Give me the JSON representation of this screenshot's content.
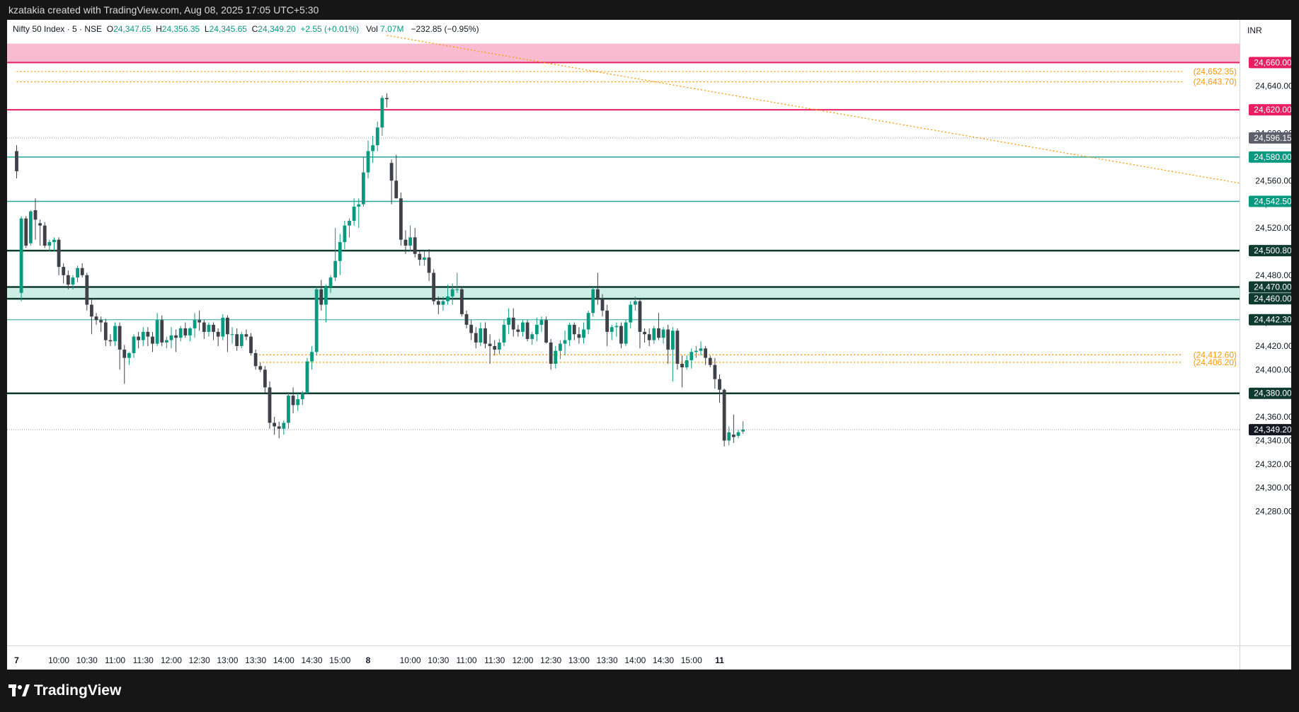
{
  "header": {
    "attribution": "kzatakia created with TradingView.com, Aug 08, 2025 17:05 UTC+5:30"
  },
  "brand": {
    "name": "TradingView",
    "logo_icon": "tradingview-logo-icon"
  },
  "legend": {
    "symbol": "Nifty 50 Index · 5 · NSE",
    "open_label": "O",
    "open": "24,347.65",
    "high_label": "H",
    "high": "24,356.35",
    "low_label": "L",
    "low": "24,345.65",
    "close_label": "C",
    "close": "24,349.20",
    "change": "+2.55 (+0.01%)",
    "vol_label": "Vol",
    "vol": "7.07M",
    "day_change": "−232.85 (−0.95%)"
  },
  "currency": "INR",
  "colors": {
    "up": "#089981",
    "down": "#3f4149",
    "resistance": "#e91e63",
    "resistance_zone": "#f8bbd0",
    "teal_line": "#26a69a",
    "dark_line": "#0e3b2e",
    "support_zone": "#cdeee6",
    "orange": "#ff9800",
    "current_price": "#131722"
  },
  "chart_data": {
    "type": "candlestick",
    "title": "Nifty 50 Index · 5 · NSE",
    "ylim": [
      24260,
      24665
    ],
    "y_ticks": [
      "24,280.00",
      "24,300.00",
      "24,320.00",
      "24,340.00",
      "24,360.00",
      "24,380.00",
      "24,400.00",
      "24,420.00",
      "24,440.00",
      "24,460.00",
      "24,480.00",
      "24,500.00",
      "24,520.00",
      "24,540.00",
      "24,560.00",
      "24,580.00",
      "24,600.00",
      "24,620.00",
      "24,640.00",
      "24,660.00"
    ],
    "x_ticks": [
      {
        "label": "7",
        "bar": 0
      },
      {
        "label": "10:00",
        "bar": 9
      },
      {
        "label": "10:30",
        "bar": 15
      },
      {
        "label": "11:00",
        "bar": 21
      },
      {
        "label": "11:30",
        "bar": 27
      },
      {
        "label": "12:00",
        "bar": 33
      },
      {
        "label": "12:30",
        "bar": 39
      },
      {
        "label": "13:00",
        "bar": 45
      },
      {
        "label": "13:30",
        "bar": 51
      },
      {
        "label": "14:00",
        "bar": 57
      },
      {
        "label": "14:30",
        "bar": 63
      },
      {
        "label": "15:00",
        "bar": 69
      },
      {
        "label": "8",
        "bar": 75
      },
      {
        "label": "10:00",
        "bar": 84
      },
      {
        "label": "10:30",
        "bar": 90
      },
      {
        "label": "11:00",
        "bar": 96
      },
      {
        "label": "11:30",
        "bar": 102
      },
      {
        "label": "12:00",
        "bar": 108
      },
      {
        "label": "12:30",
        "bar": 114
      },
      {
        "label": "13:00",
        "bar": 120
      },
      {
        "label": "13:30",
        "bar": 126
      },
      {
        "label": "14:00",
        "bar": 132
      },
      {
        "label": "14:30",
        "bar": 138
      },
      {
        "label": "15:00",
        "bar": 144
      },
      {
        "label": "11",
        "bar": 150
      }
    ],
    "levels": [
      {
        "price": 24660.0,
        "label": "24,660.00",
        "style": "resistance"
      },
      {
        "price": 24620.0,
        "label": "24,620.00",
        "style": "resistance"
      },
      {
        "price": 24596.15,
        "label": "24,596.15",
        "style": "prev-close"
      },
      {
        "price": 24580.0,
        "label": "24,580.00",
        "style": "teal"
      },
      {
        "price": 24542.5,
        "label": "24,542.50",
        "style": "teal"
      },
      {
        "price": 24500.8,
        "label": "24,500.80",
        "style": "dark"
      },
      {
        "price": 24470.0,
        "label": "24,470.00",
        "style": "dark"
      },
      {
        "price": 24460.0,
        "label": "24,460.00",
        "style": "dark"
      },
      {
        "price": 24442.3,
        "label": "24,442.30",
        "style": "teal-thin"
      },
      {
        "price": 24380.0,
        "label": "24,380.00",
        "style": "dark"
      },
      {
        "price": 24349.2,
        "label": "24,349.20",
        "style": "current"
      }
    ],
    "dotted_levels": [
      {
        "price": 24652.35,
        "label": "(24,652.35)",
        "from_bar": 0
      },
      {
        "price": 24643.7,
        "label": "(24,643.70)",
        "from_bar": 0
      },
      {
        "price": 24412.6,
        "label": "(24,412.60)",
        "from_bar": 51
      },
      {
        "price": 24406.2,
        "label": "(24,406.20)",
        "from_bar": 51
      }
    ],
    "zones": [
      {
        "from": 24660,
        "to": 24676,
        "style": "resistance-zone"
      },
      {
        "from": 24460,
        "to": 24470,
        "style": "support-zone"
      }
    ],
    "trendline": {
      "bar1": 79,
      "price1": 24683,
      "bar2": 159,
      "price2": 24628
    },
    "candles": [
      [
        24585,
        24590,
        24562,
        24568
      ],
      [
        24465,
        24530,
        24458,
        24528
      ],
      [
        24528,
        24530,
        24503,
        24505
      ],
      [
        24507,
        24535,
        24505,
        24534
      ],
      [
        24535,
        24545,
        24510,
        24527
      ],
      [
        24524,
        24527,
        24505,
        24522
      ],
      [
        24522,
        24525,
        24503,
        24505
      ],
      [
        24505,
        24510,
        24500,
        24508
      ],
      [
        24508,
        24512,
        24500,
        24510
      ],
      [
        24510,
        24512,
        24480,
        24487
      ],
      [
        24487,
        24490,
        24473,
        24480
      ],
      [
        24480,
        24484,
        24468,
        24472
      ],
      [
        24472,
        24480,
        24468,
        24478
      ],
      [
        24478,
        24488,
        24474,
        24486
      ],
      [
        24486,
        24490,
        24478,
        24480
      ],
      [
        24480,
        24482,
        24450,
        24455
      ],
      [
        24455,
        24460,
        24430,
        24445
      ],
      [
        24445,
        24448,
        24438,
        24442
      ],
      [
        24442,
        24445,
        24432,
        24440
      ],
      [
        24440,
        24443,
        24420,
        24425
      ],
      [
        24425,
        24430,
        24420,
        24424
      ],
      [
        24424,
        24440,
        24420,
        24437
      ],
      [
        24437,
        24440,
        24400,
        24417
      ],
      [
        24417,
        24421,
        24388,
        24410
      ],
      [
        24410,
        24415,
        24404,
        24414
      ],
      [
        24414,
        24430,
        24410,
        24428
      ],
      [
        24428,
        24432,
        24418,
        24425
      ],
      [
        24425,
        24436,
        24420,
        24432
      ],
      [
        24432,
        24436,
        24420,
        24428
      ],
      [
        24428,
        24432,
        24415,
        24422
      ],
      [
        24422,
        24448,
        24420,
        24442
      ],
      [
        24442,
        24446,
        24420,
        24423
      ],
      [
        24423,
        24428,
        24418,
        24425
      ],
      [
        24425,
        24436,
        24418,
        24429
      ],
      [
        24429,
        24434,
        24415,
        24427
      ],
      [
        24427,
        24437,
        24424,
        24435
      ],
      [
        24435,
        24440,
        24427,
        24429
      ],
      [
        24429,
        24436,
        24424,
        24435
      ],
      [
        24435,
        24448,
        24427,
        24442
      ],
      [
        24442,
        24450,
        24433,
        24440
      ],
      [
        24440,
        24442,
        24426,
        24432
      ],
      [
        24432,
        24440,
        24428,
        24438
      ],
      [
        24438,
        24440,
        24425,
        24432
      ],
      [
        24432,
        24435,
        24420,
        24428
      ],
      [
        24428,
        24447,
        24425,
        24444
      ],
      [
        24444,
        24446,
        24415,
        24430
      ],
      [
        24430,
        24436,
        24422,
        24430
      ],
      [
        24430,
        24435,
        24416,
        24420
      ],
      [
        24420,
        24432,
        24418,
        24430
      ],
      [
        24430,
        24434,
        24425,
        24428
      ],
      [
        24428,
        24431,
        24412,
        24414
      ],
      [
        24414,
        24417,
        24400,
        24403
      ],
      [
        24403,
        24406,
        24398,
        24400
      ],
      [
        24400,
        24403,
        24380,
        24385
      ],
      [
        24385,
        24390,
        24350,
        24355
      ],
      [
        24355,
        24360,
        24345,
        24352
      ],
      [
        24352,
        24356,
        24342,
        24350
      ],
      [
        24350,
        24357,
        24345,
        24355
      ],
      [
        24355,
        24380,
        24350,
        24378
      ],
      [
        24378,
        24385,
        24363,
        24370
      ],
      [
        24370,
        24380,
        24365,
        24375
      ],
      [
        24375,
        24382,
        24370,
        24380
      ],
      [
        24380,
        24410,
        24380,
        24407
      ],
      [
        24407,
        24420,
        24400,
        24415
      ],
      [
        24415,
        24470,
        24412,
        24468
      ],
      [
        24468,
        24476,
        24450,
        24455
      ],
      [
        24455,
        24472,
        24440,
        24470
      ],
      [
        24470,
        24480,
        24465,
        24478
      ],
      [
        24478,
        24520,
        24475,
        24492
      ],
      [
        24492,
        24515,
        24480,
        24508
      ],
      [
        24508,
        24526,
        24502,
        24522
      ],
      [
        24522,
        24528,
        24512,
        24526
      ],
      [
        24526,
        24545,
        24522,
        24538
      ],
      [
        24538,
        24545,
        24520,
        24540
      ],
      [
        24540,
        24580,
        24538,
        24567
      ],
      [
        24567,
        24594,
        24562,
        24585
      ],
      [
        24585,
        24598,
        24575,
        24590
      ],
      [
        24590,
        24610,
        24585,
        24605
      ],
      [
        24605,
        24632,
        24598,
        24630
      ],
      [
        24630,
        24634,
        24622,
        24629
      ],
      [
        24575,
        24578,
        24540,
        24560
      ],
      [
        24560,
        24582,
        24555,
        24545
      ],
      [
        24545,
        24550,
        24505,
        24510
      ],
      [
        24510,
        24518,
        24498,
        24505
      ],
      [
        24505,
        24522,
        24500,
        24512
      ],
      [
        24512,
        24520,
        24495,
        24498
      ],
      [
        24498,
        24500,
        24488,
        24493
      ],
      [
        24493,
        24500,
        24488,
        24495
      ],
      [
        24495,
        24502,
        24475,
        24482
      ],
      [
        24482,
        24485,
        24455,
        24458
      ],
      [
        24458,
        24462,
        24447,
        24455
      ],
      [
        24455,
        24462,
        24450,
        24458
      ],
      [
        24458,
        24472,
        24455,
        24462
      ],
      [
        24462,
        24473,
        24455,
        24468
      ],
      [
        24468,
        24482,
        24465,
        24468
      ],
      [
        24468,
        24470,
        24445,
        24447
      ],
      [
        24447,
        24450,
        24435,
        24438
      ],
      [
        24438,
        24442,
        24425,
        24431
      ],
      [
        24431,
        24436,
        24418,
        24423
      ],
      [
        24423,
        24440,
        24420,
        24435
      ],
      [
        24435,
        24440,
        24418,
        24422
      ],
      [
        24422,
        24430,
        24405,
        24420
      ],
      [
        24420,
        24425,
        24412,
        24417
      ],
      [
        24417,
        24426,
        24413,
        24423
      ],
      [
        24423,
        24442,
        24420,
        24438
      ],
      [
        24438,
        24452,
        24430,
        24444
      ],
      [
        24444,
        24452,
        24428,
        24434
      ],
      [
        24434,
        24438,
        24428,
        24432
      ],
      [
        24432,
        24442,
        24428,
        24440
      ],
      [
        24440,
        24442,
        24424,
        24426
      ],
      [
        24426,
        24432,
        24421,
        24430
      ],
      [
        24430,
        24444,
        24424,
        24438
      ],
      [
        24438,
        24445,
        24432,
        24442
      ],
      [
        24442,
        24445,
        24422,
        24423
      ],
      [
        24423,
        24426,
        24400,
        24405
      ],
      [
        24405,
        24420,
        24401,
        24416
      ],
      [
        24416,
        24425,
        24409,
        24422
      ],
      [
        24422,
        24433,
        24412,
        24425
      ],
      [
        24425,
        24440,
        24420,
        24438
      ],
      [
        24438,
        24440,
        24425,
        24430
      ],
      [
        24430,
        24436,
        24422,
        24427
      ],
      [
        24427,
        24440,
        24422,
        24434
      ],
      [
        24434,
        24450,
        24430,
        24448
      ],
      [
        24448,
        24470,
        24445,
        24468
      ],
      [
        24468,
        24482,
        24455,
        24460
      ],
      [
        24460,
        24464,
        24445,
        24450
      ],
      [
        24450,
        24455,
        24420,
        24432
      ],
      [
        24432,
        24438,
        24425,
        24436
      ],
      [
        24436,
        24440,
        24428,
        24437
      ],
      [
        24437,
        24440,
        24418,
        24422
      ],
      [
        24422,
        24442,
        24420,
        24440
      ],
      [
        24440,
        24458,
        24435,
        24455
      ],
      [
        24455,
        24462,
        24450,
        24458
      ],
      [
        24458,
        24460,
        24418,
        24432
      ],
      [
        24432,
        24435,
        24423,
        24430
      ],
      [
        24430,
        24435,
        24420,
        24425
      ],
      [
        24425,
        24437,
        24422,
        24435
      ],
      [
        24435,
        24448,
        24425,
        24427
      ],
      [
        24427,
        24436,
        24422,
        24434
      ],
      [
        24434,
        24438,
        24405,
        24417
      ],
      [
        24417,
        24436,
        24390,
        24433
      ],
      [
        24433,
        24435,
        24400,
        24405
      ],
      [
        24405,
        24412,
        24385,
        24402
      ],
      [
        24402,
        24412,
        24400,
        24408
      ],
      [
        24408,
        24418,
        24401,
        24415
      ],
      [
        24415,
        24420,
        24410,
        24416
      ],
      [
        24416,
        24424,
        24412,
        24418
      ],
      [
        24418,
        24420,
        24404,
        24410
      ],
      [
        24410,
        24412,
        24402,
        24404
      ],
      [
        24404,
        24410,
        24384,
        24392
      ],
      [
        24392,
        24396,
        24372,
        24383
      ],
      [
        24383,
        24384,
        24335,
        24340
      ],
      [
        24340,
        24352,
        24336,
        24347
      ],
      [
        24345,
        24362,
        24338,
        24343
      ],
      [
        24344,
        24349,
        24342,
        24347
      ],
      [
        24347.65,
        24356.35,
        24345.65,
        24349.2
      ]
    ]
  }
}
